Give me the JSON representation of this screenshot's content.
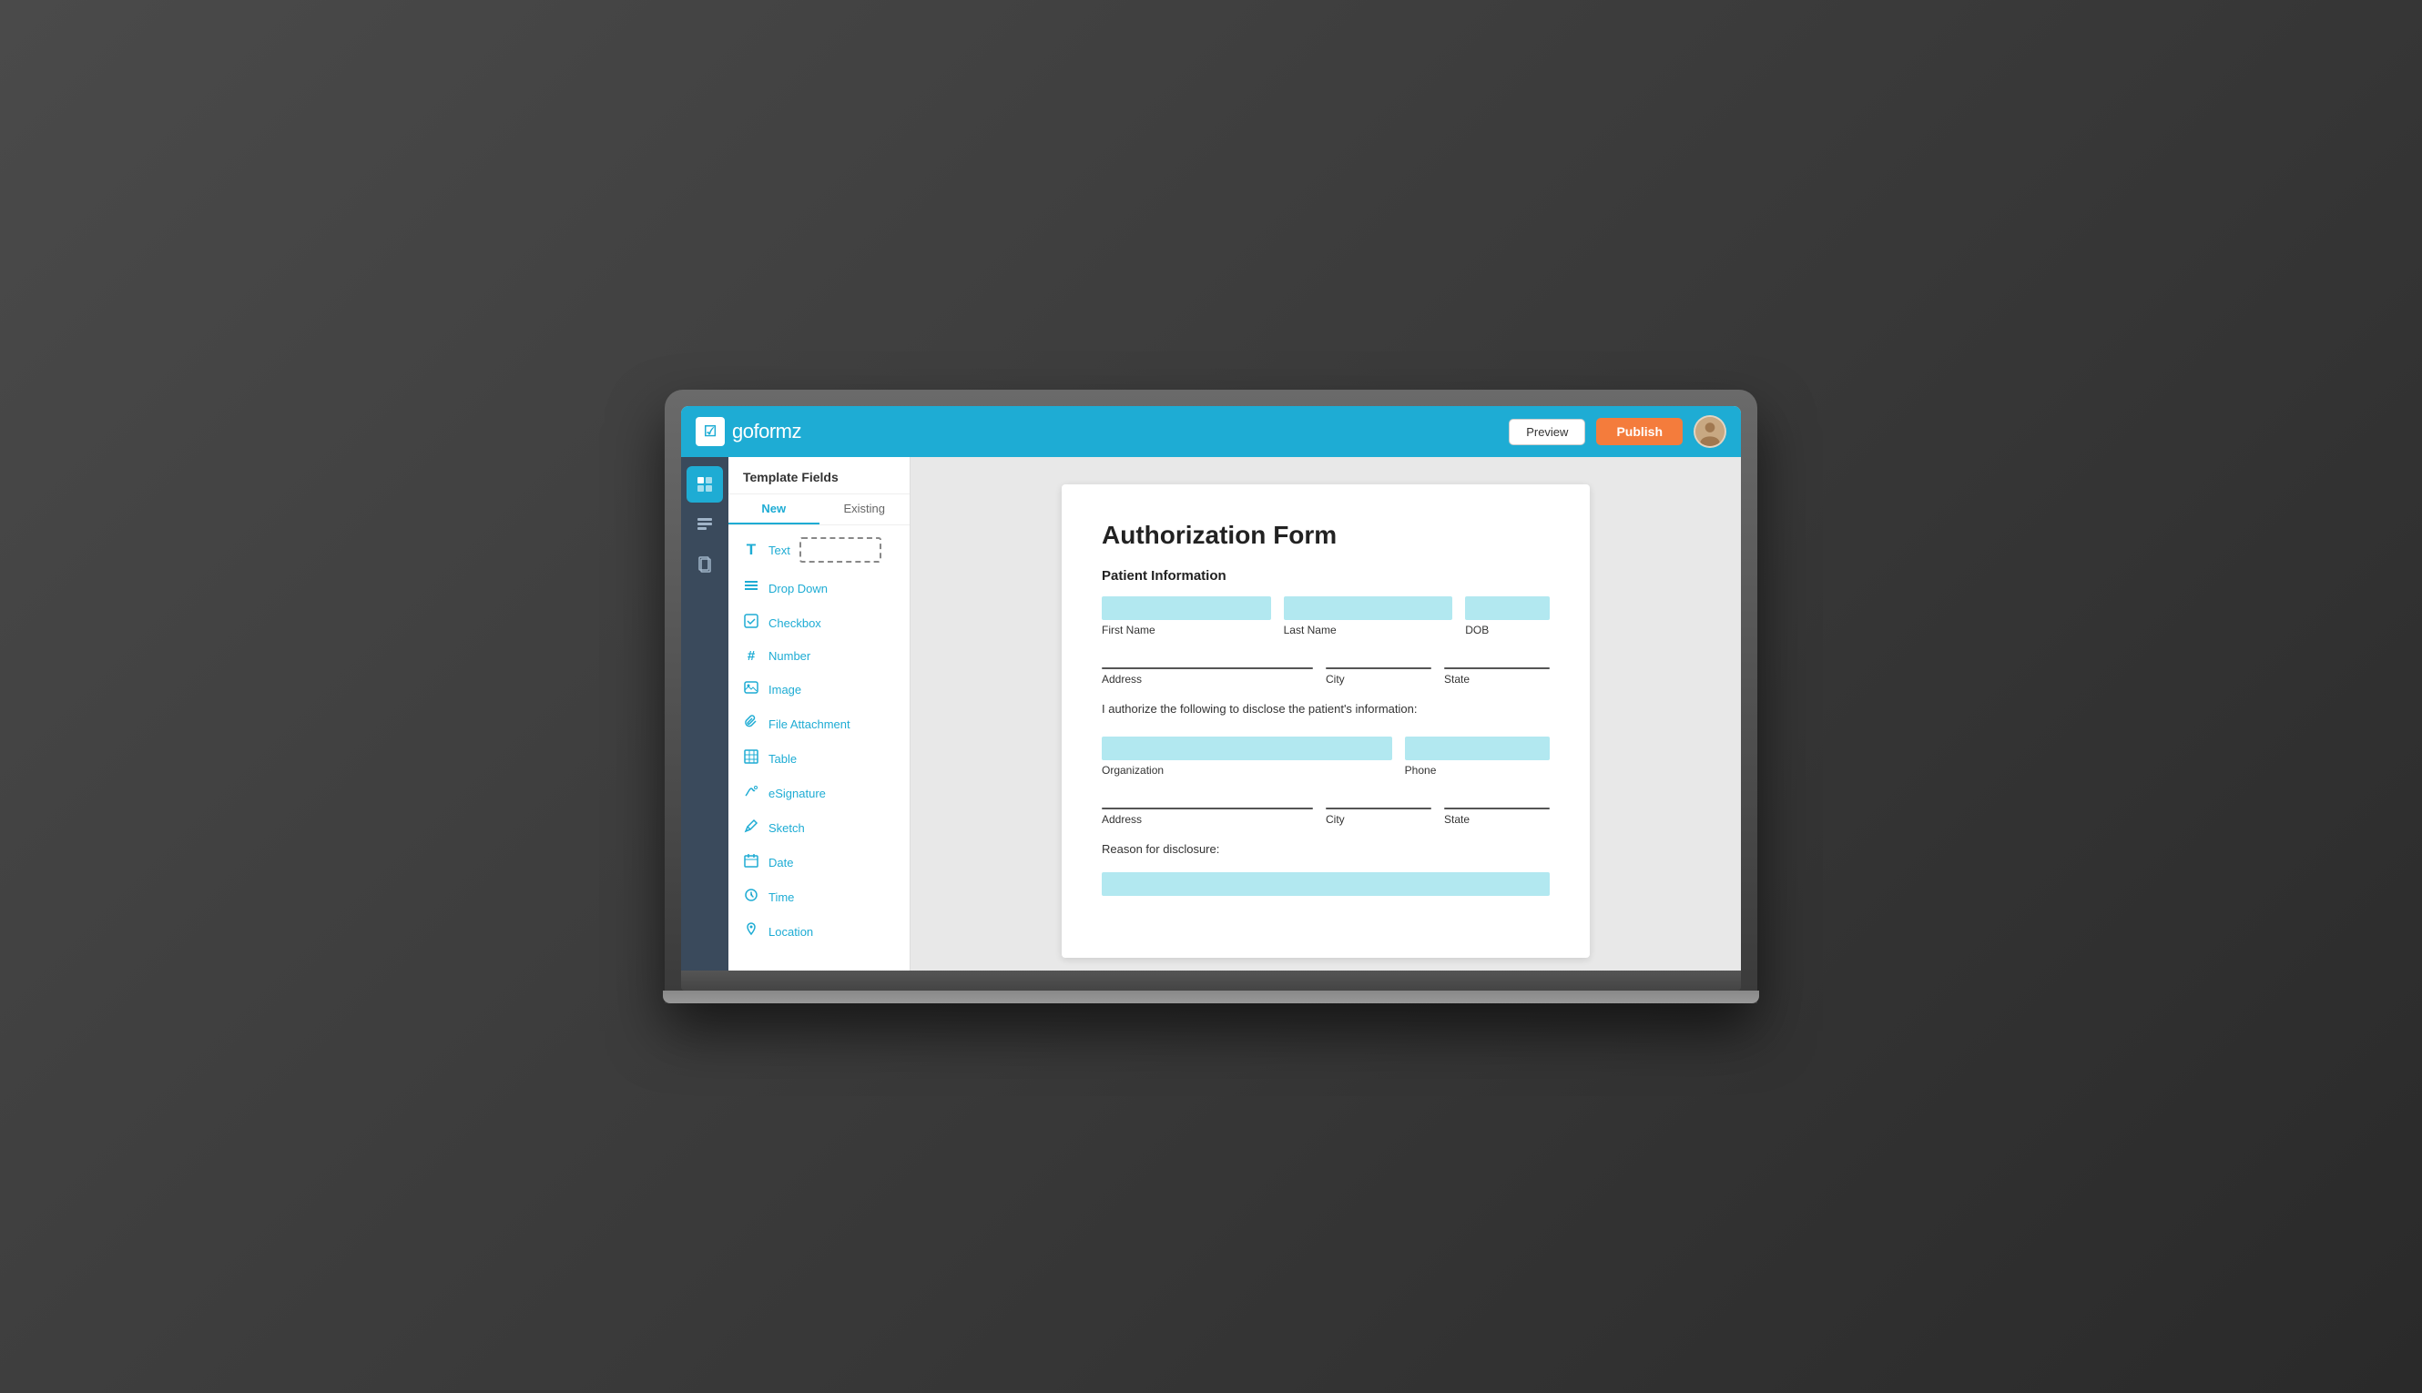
{
  "app": {
    "logo_text_go": "go",
    "logo_text_formz": "formz",
    "logo_icon": "☑"
  },
  "toolbar": {
    "preview_label": "Preview",
    "publish_label": "Publish"
  },
  "template_panel": {
    "title": "Template Fields",
    "tabs": [
      {
        "label": "New",
        "active": true
      },
      {
        "label": "Existing",
        "active": false
      }
    ],
    "fields": [
      {
        "icon": "T",
        "label": "Text",
        "icon_type": "text"
      },
      {
        "icon": "≡",
        "label": "Drop Down",
        "icon_type": "dropdown"
      },
      {
        "icon": "☑",
        "label": "Checkbox",
        "icon_type": "checkbox"
      },
      {
        "icon": "#",
        "label": "Number",
        "icon_type": "number"
      },
      {
        "icon": "🖼",
        "label": "Image",
        "icon_type": "image"
      },
      {
        "icon": "📎",
        "label": "File Attachment",
        "icon_type": "attachment"
      },
      {
        "icon": "⊞",
        "label": "Table",
        "icon_type": "table"
      },
      {
        "icon": "✍",
        "label": "eSignature",
        "icon_type": "esignature"
      },
      {
        "icon": "✏",
        "label": "Sketch",
        "icon_type": "sketch"
      },
      {
        "icon": "📅",
        "label": "Date",
        "icon_type": "date"
      },
      {
        "icon": "🕐",
        "label": "Time",
        "icon_type": "time"
      },
      {
        "icon": "📍",
        "label": "Location",
        "icon_type": "location"
      }
    ]
  },
  "form": {
    "title": "Authorization Form",
    "section1": "Patient Information",
    "fields_row1": [
      "First Name",
      "Last Name",
      "DOB"
    ],
    "fields_row2": [
      "Address",
      "City",
      "State"
    ],
    "disclosure_text": "I authorize the following to disclose the patient's information:",
    "fields_row3_labels": [
      "Organization",
      "Phone"
    ],
    "fields_row4_labels": [
      "Address",
      "City",
      "State"
    ],
    "reason_label": "Reason for disclosure:"
  },
  "colors": {
    "accent": "#1eacd4",
    "publish_btn": "#f47c3c",
    "input_fill": "#b2e8f0",
    "sidebar_bg": "#3a4a5c"
  }
}
